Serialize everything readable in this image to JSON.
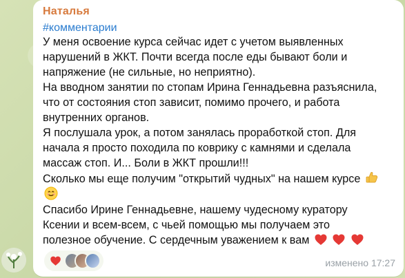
{
  "message": {
    "sender_name": "Наталья",
    "hashtag": "#комментарии",
    "lines": [
      "У меня освоение курса сейчас идет с учетом выявленных",
      "нарушений в ЖКТ. Почти всегда после еды бывают боли и",
      "напряжение (не сильные, но неприятно).",
      "На вводном занятии по стопам Ирина Геннадьевна разъяснила,",
      "что от состояния стоп зависит, помимо прочего, и работа",
      "внутренних органов.",
      "Я послушала урок, а потом занялась проработкой стоп. Для",
      "начала я просто походила по коврику с камнями и сделала",
      "массаж стоп. И... Боли в ЖКТ прошли!!!",
      "Сколько мы еще получим \"открытий чудных\" на нашем курсе",
      "",
      "Спасибо Ирине Геннадьевне, нашему чудесному куратору",
      "Ксении и всем-всем, с чьей помощью мы получаем это",
      "полезное обучение. С сердечным уважением к вам"
    ],
    "status_text": "изменено",
    "time": "17:27"
  },
  "reactions": {
    "emoji": "heart-icon",
    "avatars": [
      "reactor-avatar-1",
      "reactor-avatar-2",
      "reactor-avatar-3"
    ]
  },
  "colors": {
    "sender": "#d77a3d",
    "hashtag": "#2a7ccf",
    "meta": "#99a0a6",
    "bubble": "#ffffff",
    "wallpaper": "#cfdcb0"
  }
}
